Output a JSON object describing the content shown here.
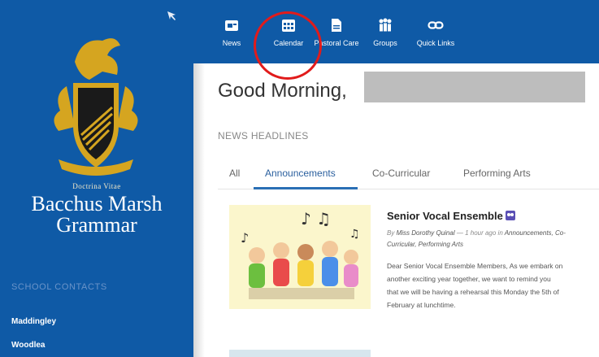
{
  "sidebar": {
    "motto": "Doctrina Vitae",
    "school_line1": "Bacchus Marsh",
    "school_line2": "Grammar",
    "contacts_heading": "SCHOOL CONTACTS",
    "contacts": [
      "Maddingley",
      "Woodlea"
    ],
    "pin_icon": "pin-icon"
  },
  "topnav": {
    "items": [
      {
        "label": "News",
        "icon": "news-icon"
      },
      {
        "label": "Calendar",
        "icon": "calendar-icon"
      },
      {
        "label": "Pastoral Care",
        "icon": "document-icon"
      },
      {
        "label": "Groups",
        "icon": "people-icon"
      },
      {
        "label": "Quick Links",
        "icon": "link-icon"
      }
    ],
    "highlighted": "Calendar"
  },
  "main": {
    "greeting": "Good Morning,",
    "news_heading": "NEWS HEADLINES",
    "tabs": [
      "All",
      "Announcements",
      "Co-Curricular",
      "Performing Arts"
    ],
    "active_tab": "Announcements",
    "article": {
      "title": "Senior Vocal Ensemble",
      "meta_prefix": "By",
      "author": "Miss Dorothy Quinal",
      "time": "— 1 hour ago in",
      "categories_a": "Announcements, Co-",
      "categories_b": "Curricular, Performing Arts",
      "body": [
        "Dear Senior Vocal Ensemble Members, As we embark on",
        "another exciting year together, we want to remind you",
        "that we will be having a rehearsal this Monday the 5th of",
        "February at lunchtime."
      ]
    }
  },
  "colors": {
    "brand_blue": "#0f5aa6",
    "gold": "#d5a520",
    "highlight_red": "#e11b1b"
  }
}
